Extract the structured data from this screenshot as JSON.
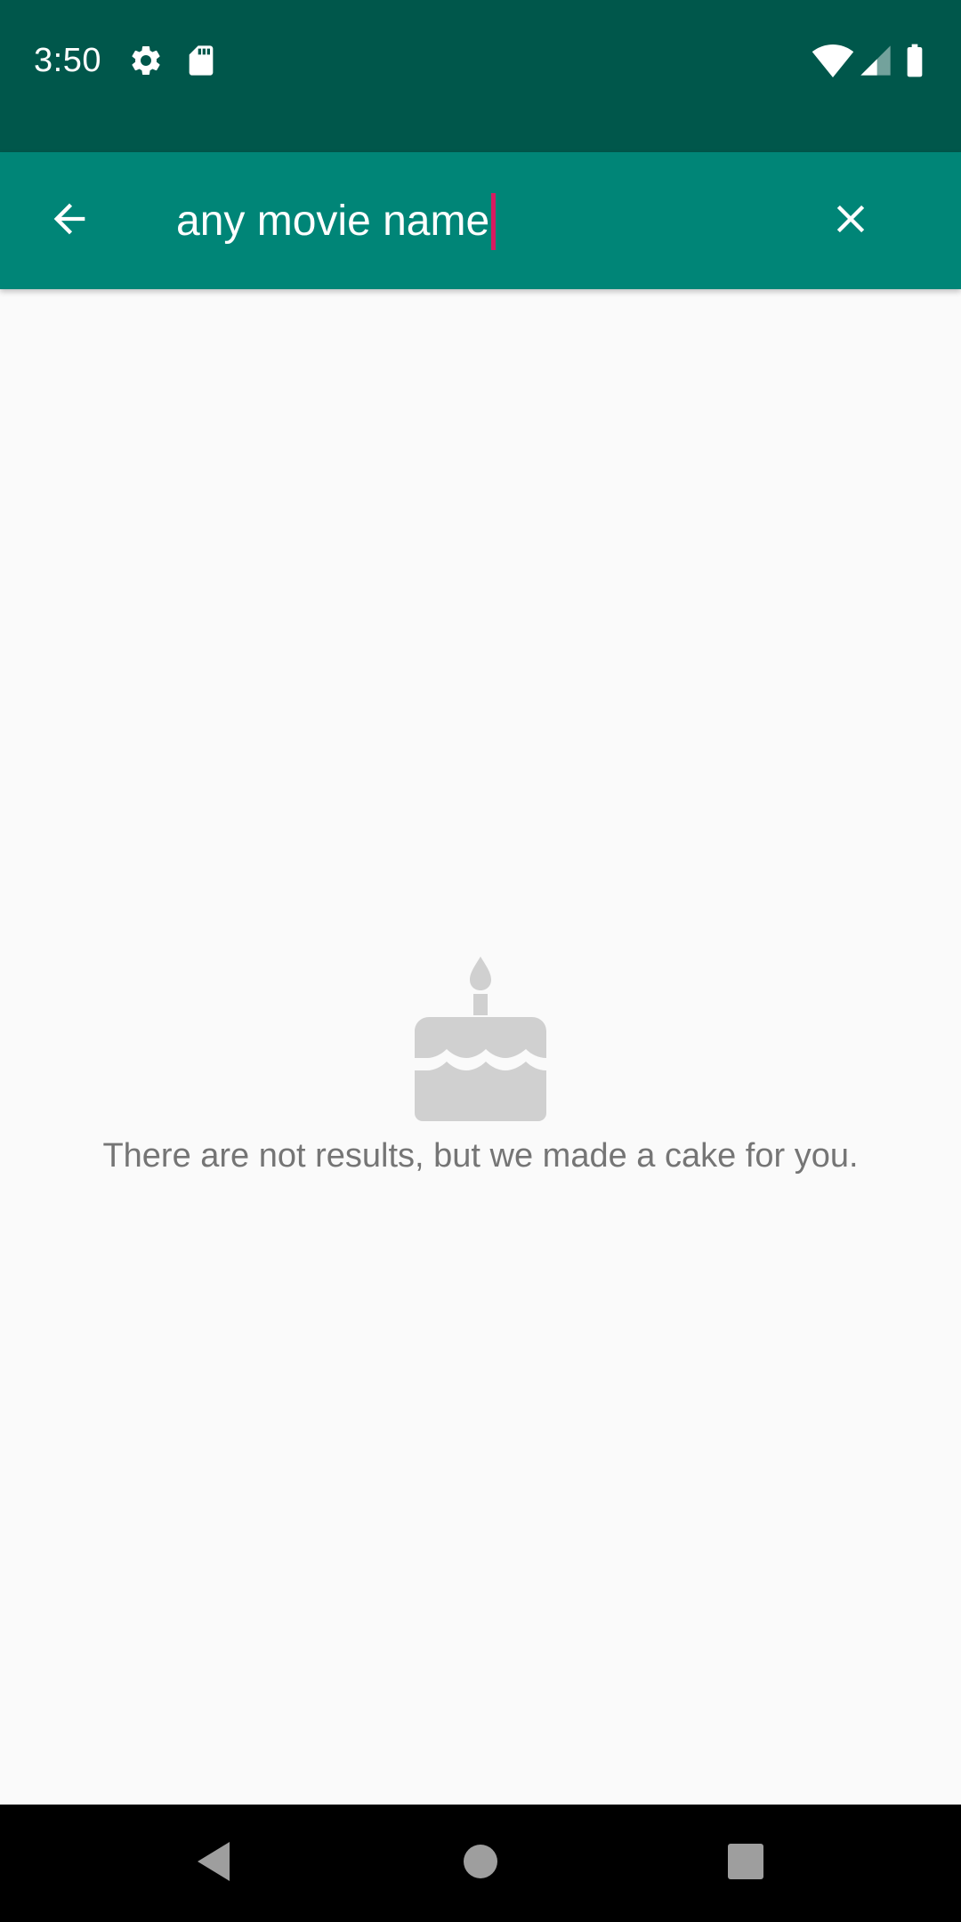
{
  "status_bar": {
    "time": "3:50",
    "left_icons": [
      "settings-icon",
      "sd-card-icon"
    ],
    "right_icons": [
      "wifi-icon",
      "cell-signal-icon",
      "battery-icon"
    ],
    "background": "#00574b"
  },
  "app_bar": {
    "background": "#008577",
    "back_icon": "arrow-back-icon",
    "clear_icon": "close-icon",
    "search": {
      "value": "any movie name"
    }
  },
  "empty_state": {
    "icon": "cake-icon",
    "message": "There are not results, but we made a cake for you."
  },
  "nav_bar": {
    "buttons": [
      "back-triangle-icon",
      "home-circle-icon",
      "recents-square-icon"
    ]
  },
  "colors": {
    "accent_caret": "#d81b60",
    "empty_icon": "#d0d0d0",
    "empty_text": "#757575"
  }
}
